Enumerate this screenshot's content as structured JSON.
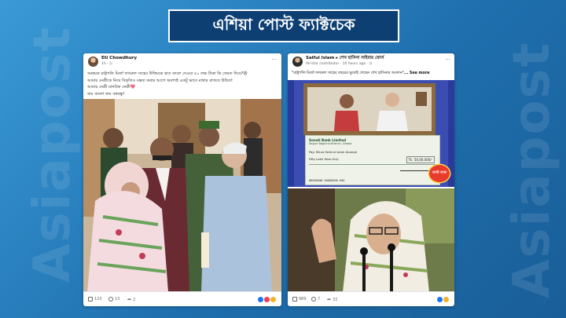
{
  "banner": {
    "title": "এশিয়া পোস্ট ফ্যাক্টচেক"
  },
  "watermark": {
    "left": "Asiapost",
    "right": "Asiapost"
  },
  "post1": {
    "author": "Eti Chowdhury",
    "meta": "1h · ◷",
    "caption_line1": "সমন্বয়ক রাষ্ট্রপতি মির্জা ফখরুল সাহেব উত্তিমকে হাত বদলে দেওয়া ৫০ লক্ষ টাকা কি ফেরত দিবে?😠",
    "caption_line2": "আমার নেত্রীকে নিয়ে বিকৃতিও মন্তব্য করার আগে অবশ্যই একটু ভাবে মাথার রাখতে উচিত!",
    "caption_line3": "আমার নেত্রী মানবিক নেত্রী💖",
    "caption_line4": "জয় বাংলা জয় বঙ্গবন্ধু!",
    "likes": "123",
    "comments": "13",
    "shares": "2"
  },
  "post2": {
    "author": "Saiful Islam",
    "group": "শেখ হাসিনা সাইবার ফোর্স",
    "meta": "All-star contributor · 10 hours ago · ◷",
    "caption": "\"রাষ্ট্রপতি মির্জা ফখরুল সাহেব বছরের ভুলেই গেছেন শেখ হাসিনার অবদান\"",
    "see_more": "... See more",
    "cheque_bank": "Sonali Bank Limited",
    "cheque_branch": "Segun Bagicha Branch, Dhaka",
    "cheque_payee": "Pay: Mirza Fakhrul Islam Alamgir",
    "cheque_amount_words": "Fifty Lakh Taka Only",
    "cheque_amount": "Tk. 50,00,000/-",
    "sticker": "লাস্ট লাফ",
    "likes": "989",
    "comments": "7",
    "shares": "32"
  },
  "colors": {
    "bg": "#2a84c4",
    "banner_bg": "#0d3f73",
    "fb_like": "#1877f2",
    "fb_love": "#f33e58",
    "fb_haha": "#f7b125"
  }
}
